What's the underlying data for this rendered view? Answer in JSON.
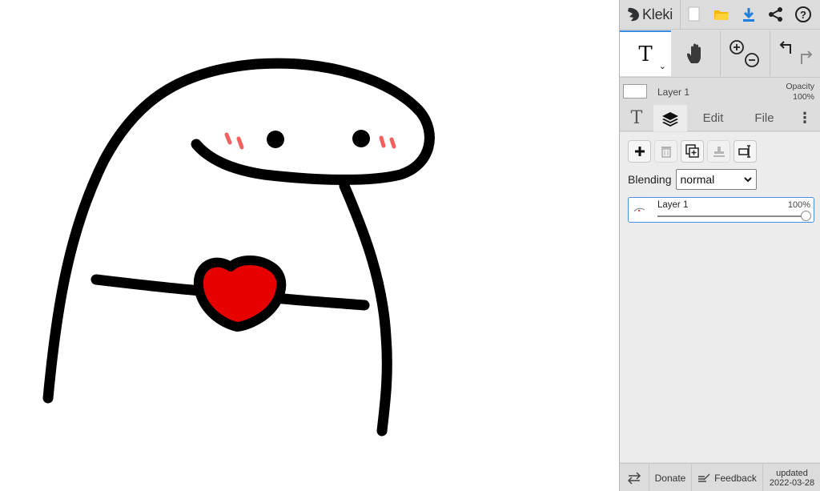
{
  "app": {
    "name": "Kleki",
    "accent_color": "#3a8de0",
    "canvas_background": "#ffffff"
  },
  "topbar": {
    "icons": [
      "kleki-logo-icon",
      "new-image-icon",
      "open-folder-icon",
      "download-icon",
      "share-icon",
      "help-icon"
    ]
  },
  "tools": {
    "active": "text",
    "text_glyph": "T",
    "chevron": "⌄",
    "icons": [
      "text-tool-icon",
      "hand-tool-icon",
      "zoom-in-icon",
      "zoom-out-icon",
      "undo-icon",
      "redo-icon"
    ]
  },
  "layer_preview": {
    "layer_name": "Layer 1",
    "opacity_label": "Opacity",
    "opacity_value": "100%"
  },
  "tabs": {
    "brush_glyph": "T",
    "layers_icon": "layers-icon",
    "edit": "Edit",
    "file": "File",
    "more": "⋮",
    "active": "layers"
  },
  "layer_panel": {
    "buttons": [
      "add-layer-icon",
      "delete-layer-icon",
      "duplicate-layer-icon",
      "merge-layer-icon",
      "rename-layer-icon"
    ],
    "blending_label": "Blending",
    "blending_value": "normal",
    "layers": [
      {
        "name": "Layer 1",
        "opacity": "100%",
        "opacity_fraction": 1.0,
        "selected": true
      }
    ]
  },
  "bottombar": {
    "swap_icon": "swap-icon",
    "donate": "Donate",
    "feedback": "Feedback",
    "updated_label": "updated",
    "updated_date": "2022-03-28"
  },
  "drawing": {
    "colors": {
      "stroke": "#000000",
      "heart": "#e60000",
      "blush": "#f26060"
    }
  }
}
